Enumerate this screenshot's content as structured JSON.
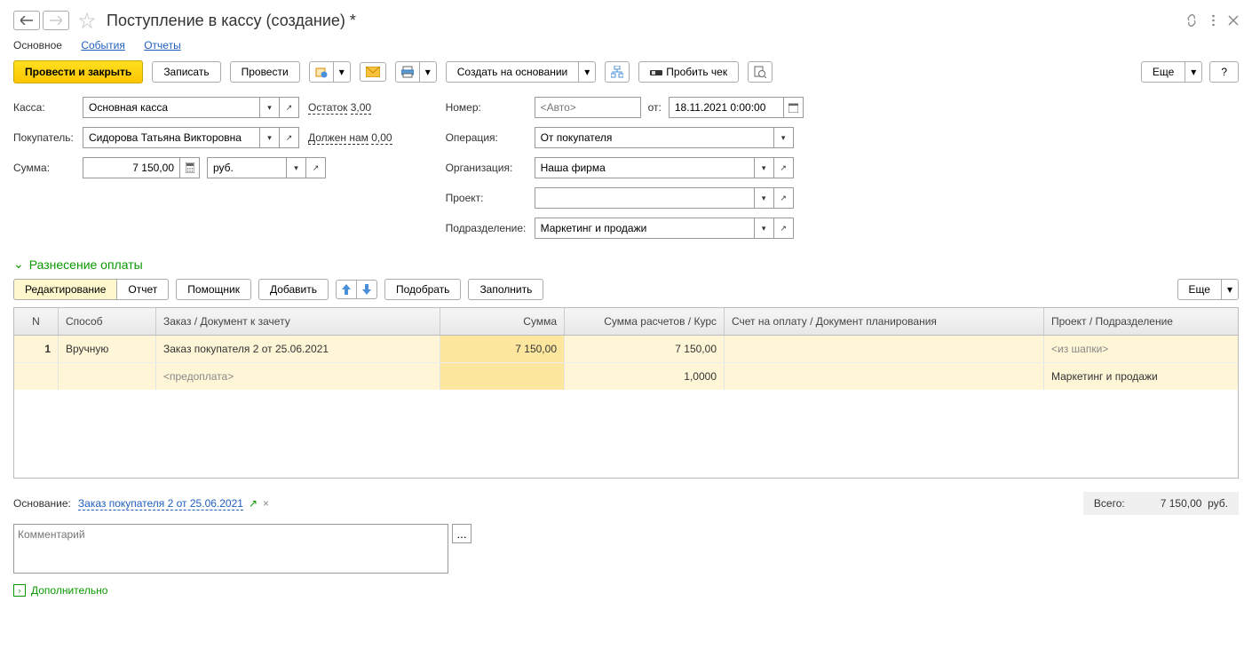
{
  "header": {
    "title": "Поступление в кассу (создание) *"
  },
  "tabs": {
    "main": "Основное",
    "events": "События",
    "reports": "Отчеты"
  },
  "toolbar": {
    "post_close": "Провести и закрыть",
    "save": "Записать",
    "post": "Провести",
    "create_based": "Создать на основании",
    "print_check": "Пробить чек",
    "more": "Еще",
    "help": "?"
  },
  "form": {
    "kassa_label": "Касса:",
    "kassa_value": "Основная касса",
    "balance_label": "Остаток",
    "balance_value": "3,00",
    "buyer_label": "Покупатель:",
    "buyer_value": "Сидорова Татьяна Викторовна",
    "debt_label": "Должен нам",
    "debt_value": "0,00",
    "sum_label": "Сумма:",
    "sum_value": "7 150,00",
    "currency": "руб.",
    "number_label": "Номер:",
    "number_placeholder": "<Авто>",
    "from_label": "от:",
    "date_value": "18.11.2021 0:00:00",
    "operation_label": "Операция:",
    "operation_value": "От покупателя",
    "org_label": "Организация:",
    "org_value": "Наша фирма",
    "project_label": "Проект:",
    "project_value": "",
    "dept_label": "Подразделение:",
    "dept_value": "Маркетинг и продажи"
  },
  "section": {
    "title": "Разнесение оплаты"
  },
  "payment_toolbar": {
    "edit": "Редактирование",
    "report": "Отчет",
    "assistant": "Помощник",
    "add": "Добавить",
    "select": "Подобрать",
    "fill": "Заполнить",
    "more": "Еще"
  },
  "grid": {
    "head": {
      "n": "N",
      "sposob": "Способ",
      "zakaz": "Заказ / Документ к зачету",
      "summa": "Сумма",
      "summa2": "Сумма расчетов / Курс",
      "schet": "Счет на оплату / Документ планирования",
      "proj": "Проект / Подразделение"
    },
    "rows": [
      {
        "n": "1",
        "sposob": "Вручную",
        "zakaz": "Заказ покупателя 2 от 25.06.2021",
        "summa": "7 150,00",
        "summa2": "7 150,00",
        "schet": "",
        "proj": "<из шапки>"
      },
      {
        "n": "",
        "sposob": "",
        "zakaz": "<предоплата>",
        "summa": "",
        "summa2": "1,0000",
        "schet": "",
        "proj": "Маркетинг и продажи"
      }
    ]
  },
  "footer": {
    "basis_label": "Основание:",
    "basis_link": "Заказ покупателя 2 от 25.06.2021",
    "total_label": "Всего:",
    "total_value": "7 150,00",
    "total_currency": "руб.",
    "comment_placeholder": "Комментарий",
    "additional": "Дополнительно"
  }
}
